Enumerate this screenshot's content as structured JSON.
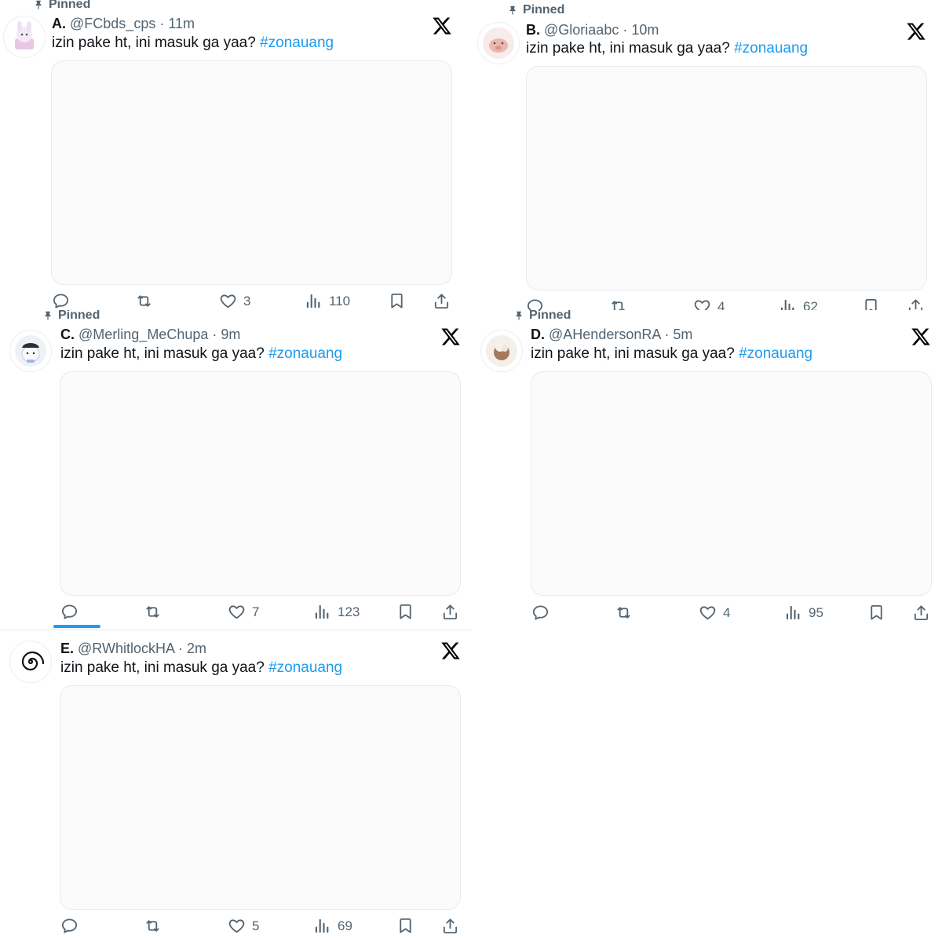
{
  "pinned_label": "Pinned",
  "tweet_text": "izin pake ht, ini masuk ga yaa?",
  "hashtag": "#zonauang",
  "tweets": [
    {
      "name": "A.",
      "handle": "@FCbds_cps",
      "time": "11m",
      "likes": "3",
      "views": "110",
      "pinned": true
    },
    {
      "name": "B.",
      "handle": "@Gloriaabc",
      "time": "10m",
      "likes": "4",
      "views": "62",
      "pinned": true
    },
    {
      "name": "C.",
      "handle": "@Merling_MeChupa",
      "time": "9m",
      "likes": "7",
      "views": "123",
      "pinned": true
    },
    {
      "name": "D.",
      "handle": "@AHendersonRA",
      "time": "5m",
      "likes": "4",
      "views": "95",
      "pinned": true
    },
    {
      "name": "E.",
      "handle": "@RWhitlockHA",
      "time": "2m",
      "likes": "5",
      "views": "69",
      "pinned": false
    }
  ],
  "colors": {
    "accent": "#1d9bf0",
    "muted": "#536471",
    "text": "#0f1419"
  },
  "icons": [
    "pin-icon",
    "x-logo-icon",
    "reply-icon",
    "retweet-icon",
    "like-icon",
    "views-icon",
    "bookmark-icon",
    "share-icon"
  ]
}
